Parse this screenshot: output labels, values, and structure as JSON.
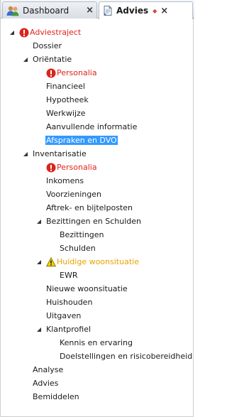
{
  "tabs": [
    {
      "label": "Dashboard",
      "close": "×"
    },
    {
      "label": "Advies",
      "close": "×"
    }
  ],
  "tree": {
    "root": "Adviestraject",
    "dossier": "Dossier",
    "orientatie": "Oriëntatie",
    "orientatie_items": {
      "personalia": "Personalia",
      "financieel": "Financieel",
      "hypotheek": "Hypotheek",
      "werkwijze": "Werkwijze",
      "aanvullende": "Aanvullende informatie",
      "afspraken": "Afspraken en DVO"
    },
    "inventarisatie": "Inventarisatie",
    "inventarisatie_items": {
      "personalia": "Personalia",
      "inkomens": "Inkomens",
      "voorzieningen": "Voorzieningen",
      "aftrek": "Aftrek- en bijtelposten",
      "bezittingen_schulden": "Bezittingen en Schulden",
      "bezittingen": "Bezittingen",
      "schulden": "Schulden",
      "huidige_woonsituatie": "Huidige woonsituatie",
      "ewr": "EWR",
      "nieuwe_woonsituatie": "Nieuwe woonsituatie",
      "huishouden": "Huishouden",
      "uitgaven": "Uitgaven",
      "klantprofiel": "Klantprofiel",
      "kennis": "Kennis en ervaring",
      "doelstellingen": "Doelstellingen en risicobereidheid"
    },
    "analyse": "Analyse",
    "advies": "Advies",
    "bemiddelen": "Bemiddelen"
  },
  "colors": {
    "error_text": "#e0241b",
    "warning_text": "#e7a300",
    "selection": "#3399ff"
  },
  "icons": {
    "error": "alert-circle-icon",
    "warning": "warning-triangle-icon",
    "expanded": "expanded-triangle-icon"
  },
  "selected_item": "Afspraken en DVO"
}
